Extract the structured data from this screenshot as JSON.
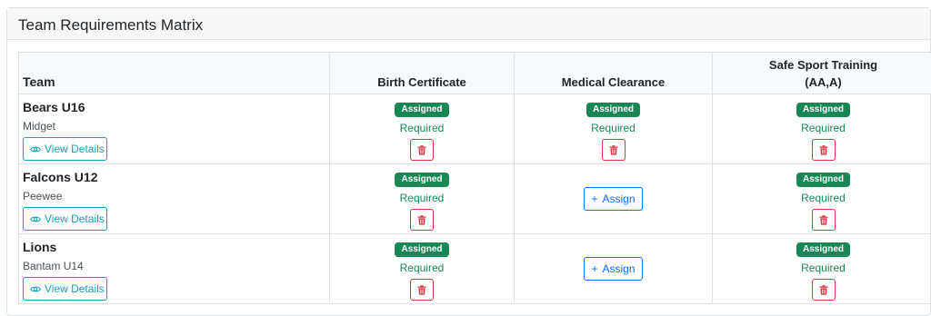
{
  "card": {
    "title": "Team Requirements Matrix"
  },
  "table": {
    "headers": {
      "team": "Team",
      "birth_certificate": "Birth Certificate",
      "medical_clearance": "Medical Clearance",
      "safe_sport": "Safe Sport Training",
      "safe_sport_sub": "(AA,A)"
    },
    "rows": [
      {
        "name": "Bears U16",
        "division": "Midget",
        "details_label": "View Details",
        "birth": {
          "badge": "Assigned",
          "status": "Required"
        },
        "medical": {
          "badge": "Assigned",
          "status": "Required"
        },
        "safe": {
          "badge": "Assigned",
          "status": "Required"
        }
      },
      {
        "name": "Falcons U12",
        "division": "Peewee",
        "details_label": "View Details",
        "birth": {
          "badge": "Assigned",
          "status": "Required"
        },
        "medical": {
          "assign_label": "Assign"
        },
        "safe": {
          "badge": "Assigned",
          "status": "Required"
        }
      },
      {
        "name": "Lions",
        "division": "Bantam U14",
        "details_label": "View Details",
        "birth": {
          "badge": "Assigned",
          "status": "Required"
        },
        "medical": {
          "assign_label": "Assign"
        },
        "safe": {
          "badge": "Assigned",
          "status": "Required"
        }
      }
    ]
  },
  "icons": {
    "details": "eye-icon",
    "delete": "trash-icon",
    "assign": "plus-icon"
  },
  "colors": {
    "success": "#198754",
    "danger": "#dc3545",
    "info": "#17a2b8",
    "primary": "#0d6efd"
  }
}
